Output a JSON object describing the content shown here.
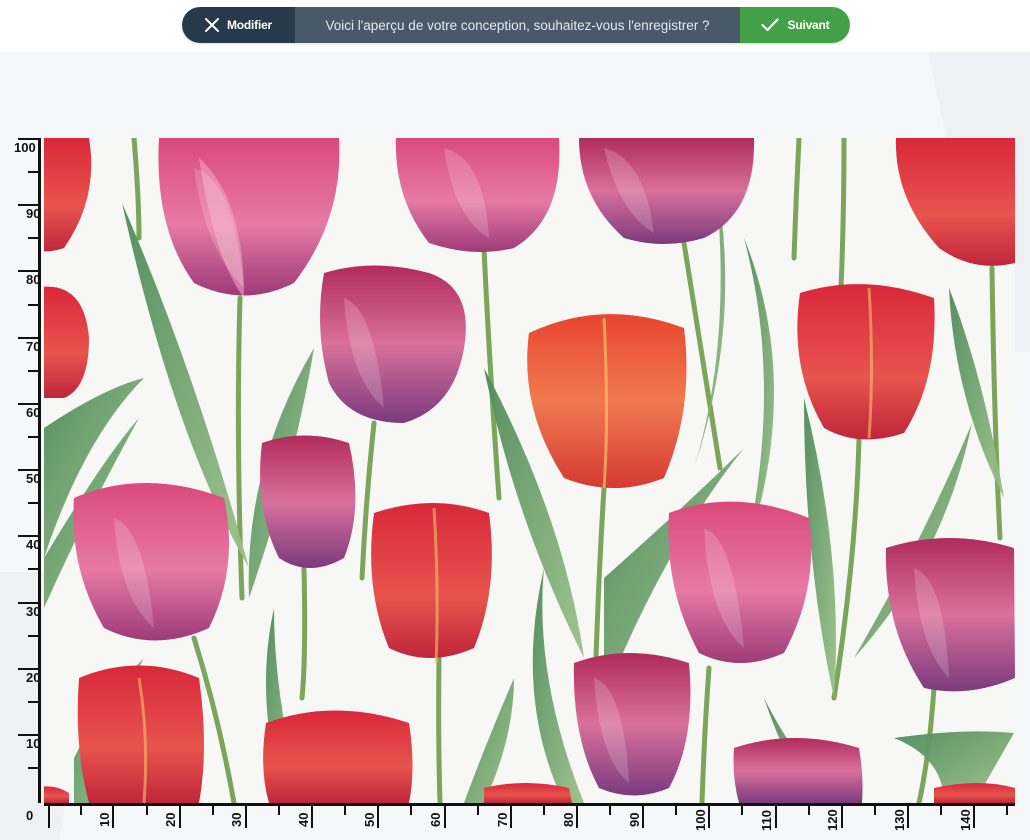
{
  "toolbar": {
    "modifier_label": "Modifier",
    "message": "Voici l'aperçu de votre conception, souhaitez-vous l'enregistrer ?",
    "suivant_label": "Suivant",
    "modifier_color": "#263a4b",
    "message_color": "#4a5967",
    "suivant_color": "#43a047"
  },
  "preview": {
    "image_name": "watercolor-tulip-pattern"
  },
  "ruler_vertical": {
    "labels": [
      "100",
      "90",
      "80",
      "70",
      "60",
      "50",
      "40",
      "30",
      "20",
      "10",
      "0"
    ]
  },
  "ruler_horizontal": {
    "labels": [
      "10",
      "20",
      "30",
      "40",
      "50",
      "60",
      "70",
      "80",
      "90",
      "100",
      "110",
      "120",
      "130",
      "140"
    ]
  }
}
